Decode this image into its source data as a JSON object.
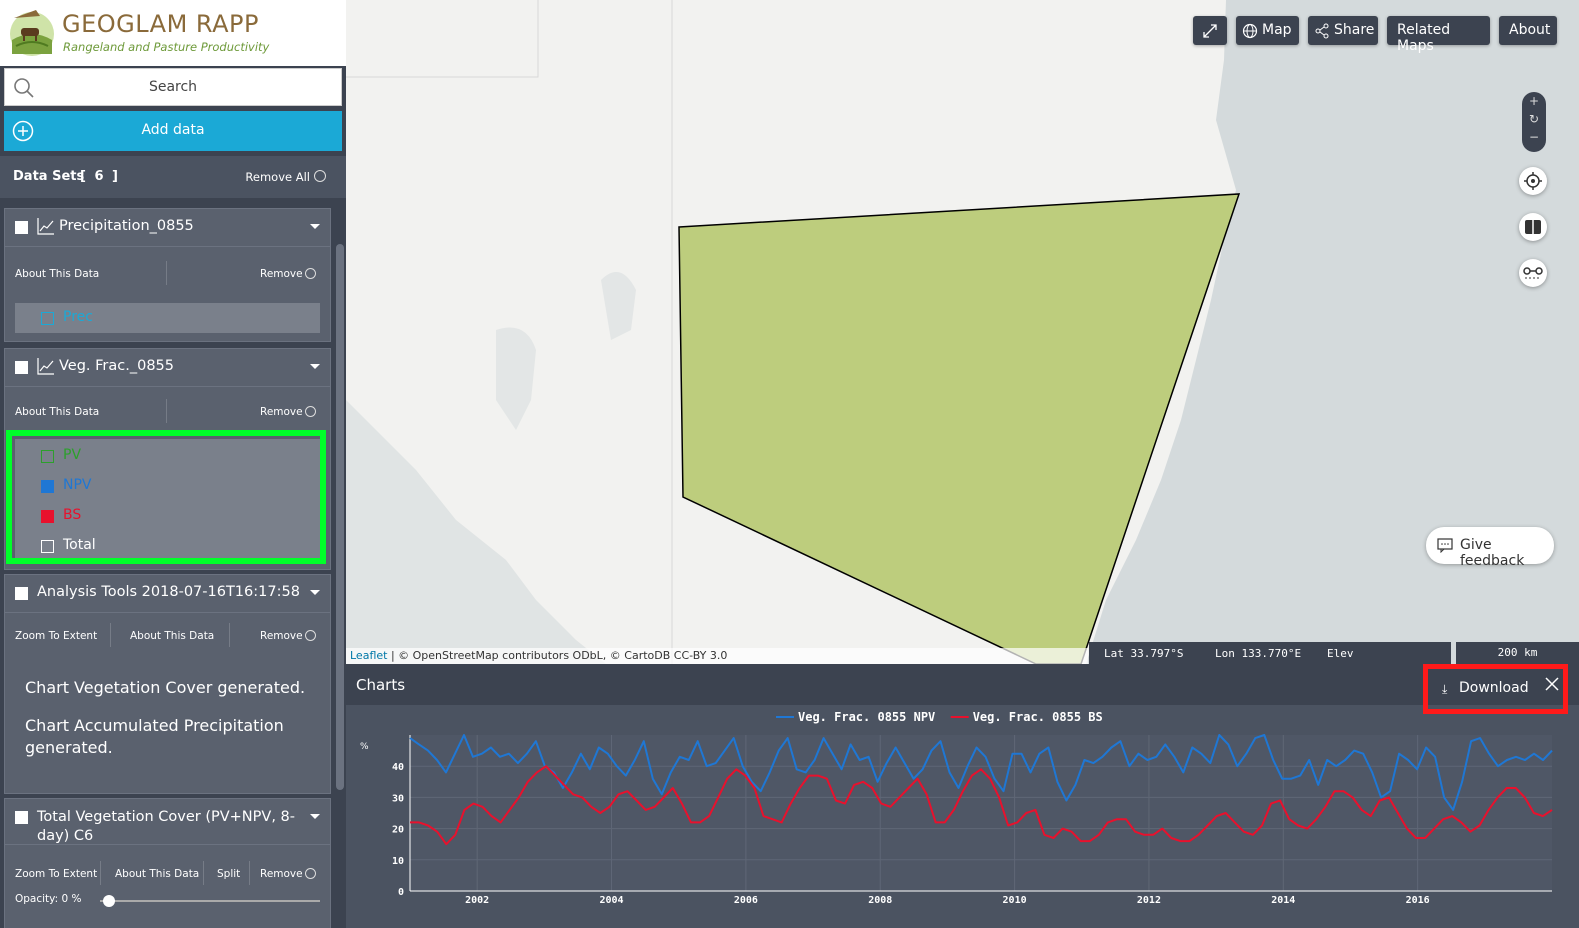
{
  "brand": {
    "title": "GEOGLAM RAPP",
    "subtitle": "Rangeland and Pasture Productivity"
  },
  "search": {
    "placeholder": "Search"
  },
  "add_data": {
    "label": "Add data"
  },
  "datasets": {
    "header": "Data Sets",
    "count": "[ 6 ]",
    "remove_all": "Remove All",
    "panels": [
      {
        "name": "Precipitation_0855",
        "actions": [
          "About This Data",
          "Remove"
        ],
        "legend": [
          {
            "label": "Prec",
            "color": "#1ba9d6"
          }
        ]
      },
      {
        "name": "Veg. Frac._0855",
        "actions": [
          "About This Data",
          "Remove"
        ],
        "legend": [
          {
            "label": "PV",
            "color": "#2ca02c"
          },
          {
            "label": "NPV",
            "color": "#1f77d4"
          },
          {
            "label": "BS",
            "color": "#e8112d"
          },
          {
            "label": "Total",
            "color": "#ffffff"
          }
        ]
      },
      {
        "name": "Analysis Tools 2018-07-16T16:17:58",
        "actions": [
          "Zoom To Extent",
          "About This Data",
          "Remove"
        ],
        "messages": [
          "Chart Vegetation Cover generated.",
          "Chart Accumulated Precipitation generated."
        ]
      },
      {
        "name": "Total Vegetation Cover (PV+NPV, 8-day) C6",
        "actions": [
          "Zoom To Extent",
          "About This Data",
          "Split",
          "Remove"
        ],
        "opacity": "Opacity: 0 %"
      }
    ]
  },
  "toolbar": {
    "expand_icon": "expand-icon",
    "map": "Map",
    "share": "Share",
    "related": "Related Maps",
    "about": "About"
  },
  "map": {
    "attribution_link": "Leaflet",
    "attribution": " | © OpenStreetMap contributors ODbL, © CartoDB CC-BY 3.0",
    "lat": "Lat  33.797°S",
    "lon": "Lon  133.770°E",
    "elev": "Elev",
    "scale": "200 km",
    "feedback": "Give feedback",
    "polygon_color": "#bdcd7d"
  },
  "charts": {
    "title": "Charts",
    "download": "Download"
  },
  "chart_data": {
    "type": "line",
    "series": [
      {
        "name": "Veg. Frac. 0855 NPV",
        "color": "#1f77d4",
        "values": [
          49,
          47,
          45,
          42,
          38,
          44,
          50,
          43,
          44,
          46,
          43,
          44,
          41,
          44,
          48,
          40,
          38,
          33,
          38,
          44,
          39,
          46,
          44,
          40,
          37,
          42,
          48,
          36,
          31,
          38,
          43,
          42,
          48,
          40,
          41,
          45,
          49,
          40,
          35,
          32,
          38,
          45,
          49,
          39,
          38,
          42,
          49,
          44,
          39,
          47,
          42,
          43,
          35,
          41,
          46,
          41,
          36,
          39,
          45,
          48,
          38,
          33,
          40,
          46,
          43,
          36,
          32,
          44,
          44,
          38,
          44,
          46,
          35,
          29,
          34,
          42,
          41,
          43,
          46,
          48,
          40,
          44,
          42,
          43,
          47,
          43,
          38,
          46,
          44,
          41,
          50,
          47,
          40,
          44,
          49,
          50,
          42,
          36,
          36,
          37,
          42,
          34,
          42,
          40,
          42,
          45,
          44,
          38,
          30,
          32,
          44,
          42,
          39,
          46,
          43,
          30,
          26,
          35,
          48,
          49,
          44,
          40,
          42,
          43,
          42,
          44,
          42,
          45
        ]
      },
      {
        "name": "Veg. Frac. 0855 BS",
        "color": "#e8112d",
        "values": [
          22,
          22,
          21,
          19,
          15,
          18,
          26,
          28,
          27,
          24,
          22,
          26,
          30,
          35,
          38,
          40,
          37,
          34,
          31,
          30,
          27,
          25,
          27,
          31,
          32,
          29,
          26,
          27,
          30,
          33,
          28,
          22,
          22,
          24,
          30,
          36,
          39,
          37,
          33,
          24,
          23,
          22,
          28,
          33,
          37,
          37,
          36,
          29,
          28,
          34,
          35,
          33,
          28,
          27,
          30,
          33,
          36,
          31,
          22,
          22,
          26,
          32,
          37,
          39,
          36,
          30,
          21,
          22,
          25,
          26,
          18,
          17,
          20,
          19,
          16,
          16,
          18,
          22,
          23,
          23,
          19,
          18,
          18,
          20,
          17,
          16,
          16,
          18,
          21,
          24,
          25,
          22,
          19,
          18,
          21,
          28,
          29,
          23,
          21,
          20,
          23,
          27,
          32,
          32,
          30,
          26,
          24,
          29,
          30,
          25,
          20,
          17,
          17,
          20,
          23,
          24,
          22,
          19,
          21,
          26,
          30,
          33,
          33,
          30,
          25,
          24,
          26
        ]
      }
    ],
    "x_start": 2001,
    "x_end": 2018,
    "xticks": [
      "2002",
      "2004",
      "2006",
      "2008",
      "2010",
      "2012",
      "2014",
      "2016"
    ],
    "yticks": [
      "0",
      "10",
      "20",
      "30",
      "40"
    ],
    "ylabel": "%",
    "ylim": [
      0,
      50
    ],
    "grid": true,
    "legend": "top-center"
  }
}
